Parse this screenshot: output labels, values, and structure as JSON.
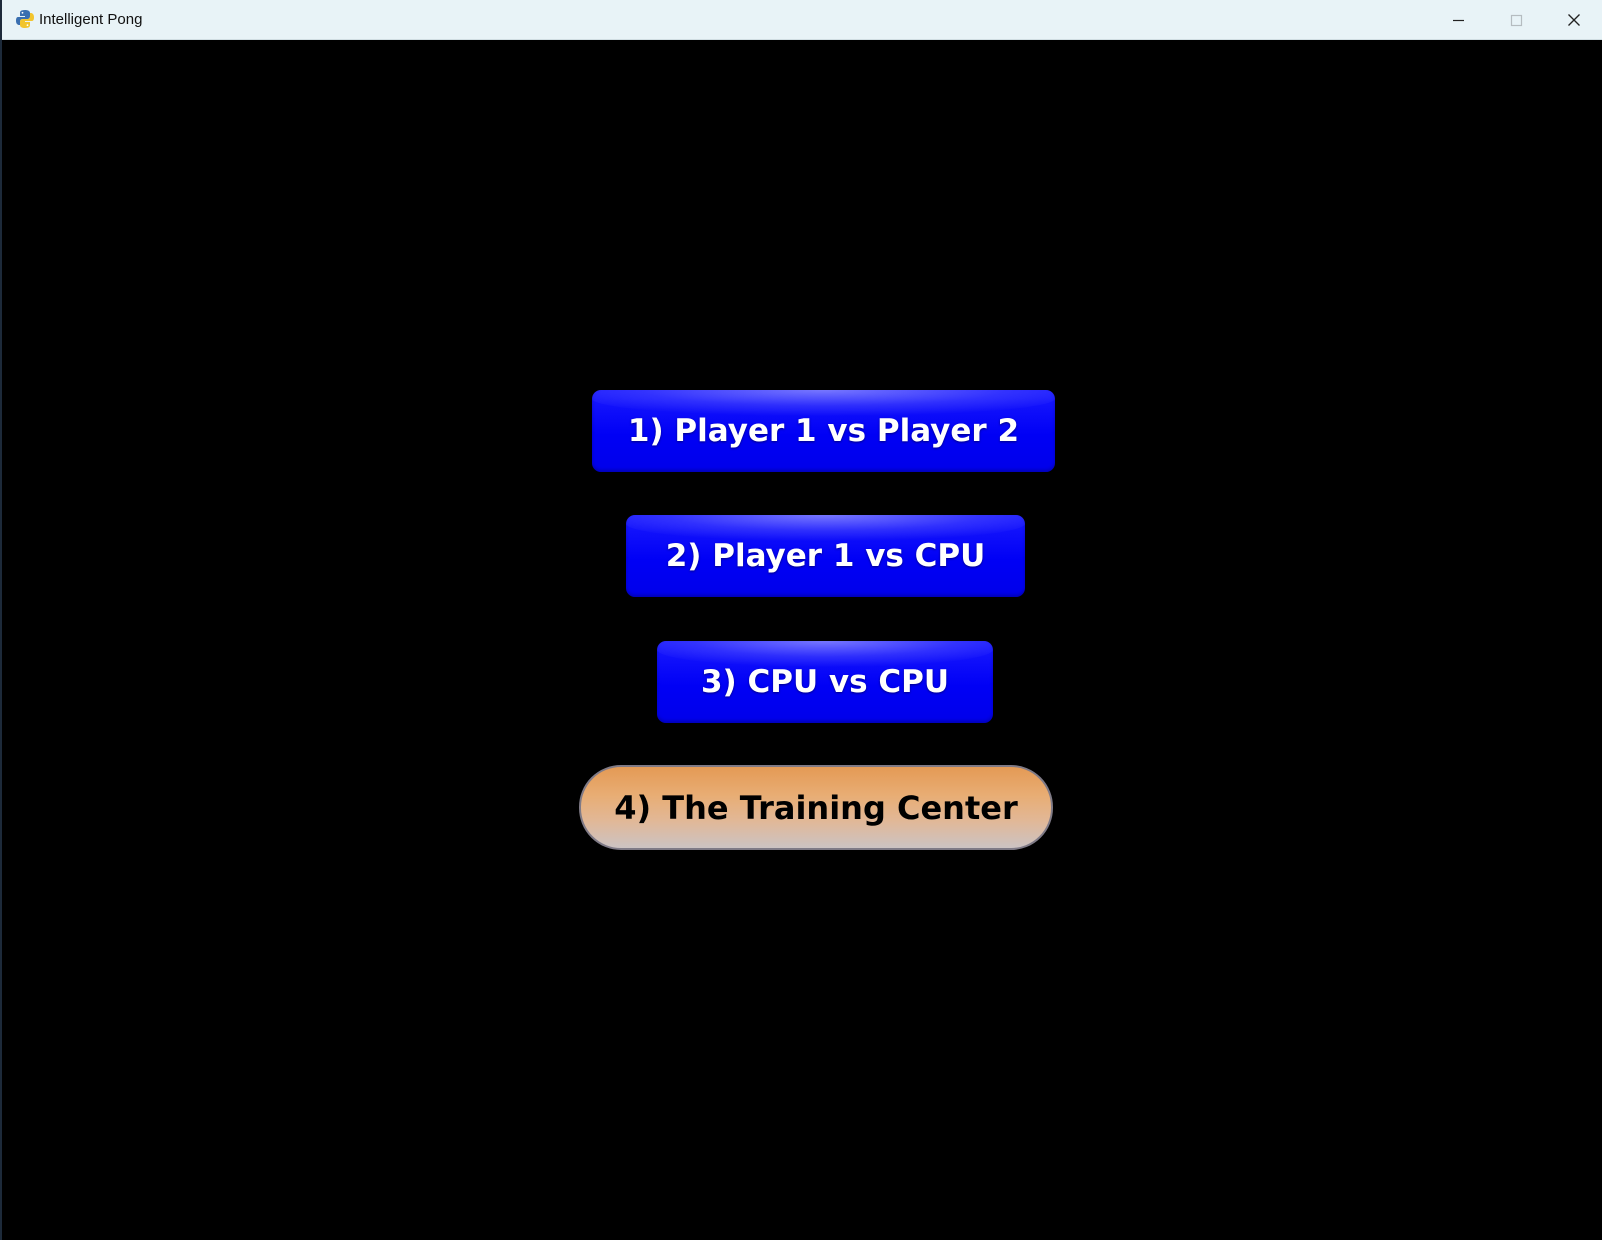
{
  "window": {
    "title": "Intelligent Pong",
    "app_icon": "python-icon"
  },
  "titlebar_controls": [
    {
      "name": "minimize-icon"
    },
    {
      "name": "maximize-icon"
    },
    {
      "name": "close-icon"
    }
  ],
  "menu": {
    "option1": "1) Player 1 vs Player 2",
    "option2": "2) Player 1 vs CPU",
    "option3": "3) CPU vs CPU",
    "option4": "4) The Training Center"
  },
  "colors": {
    "background": "#000000",
    "button_blue": "#0000f5",
    "button_orange": "#e49a55",
    "titlebar": "#e8f3f7"
  }
}
